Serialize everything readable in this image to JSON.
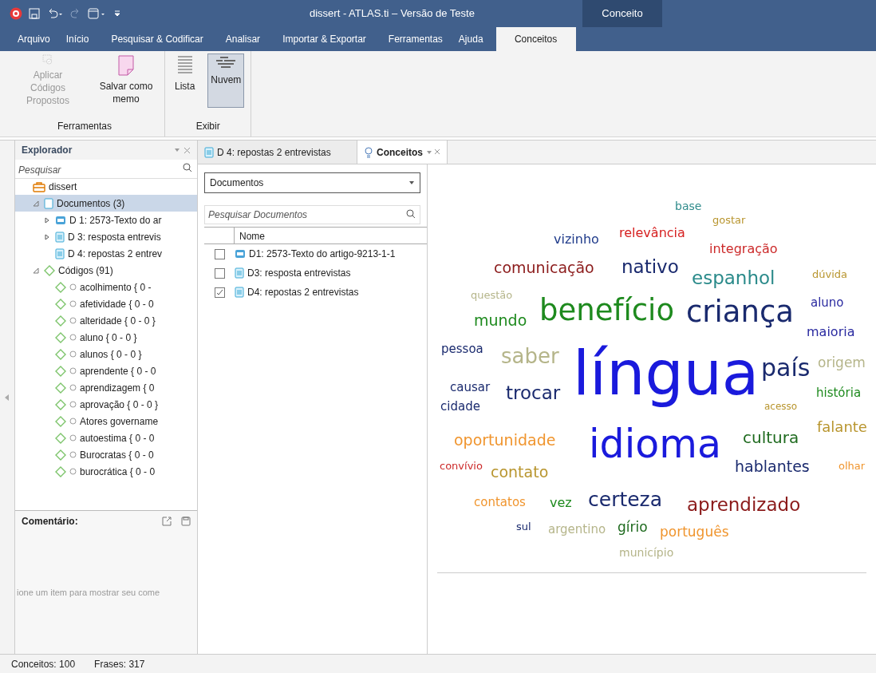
{
  "window": {
    "title": "dissert - ATLAS.ti – Versão de Teste",
    "context_tab": "Conceito"
  },
  "menu": [
    {
      "label": "Arquivo",
      "selected": false
    },
    {
      "label": "Início",
      "selected": false
    },
    {
      "label": "Pesquisar & Codificar",
      "selected": false
    },
    {
      "label": "Analisar",
      "selected": false
    },
    {
      "label": "Importar & Exportar",
      "selected": false
    },
    {
      "label": "Ferramentas",
      "selected": false
    },
    {
      "label": "Ajuda",
      "selected": false
    },
    {
      "label": "Conceitos",
      "selected": true
    }
  ],
  "ribbon": [
    {
      "label": "Ferramentas",
      "buttons": [
        {
          "kind": "apply",
          "label": "Aplicar Códigos Propostos",
          "disabled": true,
          "selected": false
        },
        {
          "kind": "memo",
          "label": "Salvar como memo",
          "disabled": false,
          "selected": false
        }
      ]
    },
    {
      "label": "Exibir",
      "buttons": [
        {
          "kind": "list",
          "label": "Lista",
          "disabled": false,
          "selected": false
        },
        {
          "kind": "cloud",
          "label": "Nuvem",
          "disabled": false,
          "selected": true
        }
      ]
    }
  ],
  "explorer": {
    "title": "Explorador",
    "search_placeholder": "Pesquisar",
    "tree": [
      {
        "kind": "project",
        "label": "dissert",
        "selected": false,
        "children": [
          {
            "kind": "folder",
            "label": "Documentos (3)",
            "selected": true,
            "expanded": true,
            "children": [
              {
                "kind": "pdf",
                "label": "D 1: 2573-Texto do ar",
                "selected": false,
                "expanded": false
              },
              {
                "kind": "doc",
                "label": "D 3: resposta entrevis",
                "selected": false,
                "expanded": false
              },
              {
                "kind": "doc",
                "label": "D 4: repostas 2 entrev",
                "selected": false
              }
            ]
          },
          {
            "kind": "codes",
            "label": "Códigos (91)",
            "selected": false,
            "expanded": true,
            "children": [
              {
                "kind": "code",
                "label": "acolhimento { 0 -",
                "selected": false
              },
              {
                "kind": "code",
                "label": "afetividade { 0 - 0",
                "selected": false
              },
              {
                "kind": "code",
                "label": "alteridade { 0 - 0 }",
                "selected": false
              },
              {
                "kind": "code",
                "label": "aluno { 0 - 0 }",
                "selected": false
              },
              {
                "kind": "code",
                "label": "alunos { 0 - 0 }",
                "selected": false
              },
              {
                "kind": "code",
                "label": "aprendente { 0 - 0",
                "selected": false
              },
              {
                "kind": "code",
                "label": "aprendizagem { 0",
                "selected": false
              },
              {
                "kind": "code",
                "label": "aprovação { 0 - 0 }",
                "selected": false
              },
              {
                "kind": "code",
                "label": "Atores govername",
                "selected": false
              },
              {
                "kind": "code",
                "label": "autoestima { 0 - 0",
                "selected": false
              },
              {
                "kind": "code",
                "label": "Burocratas { 0 - 0",
                "selected": false
              },
              {
                "kind": "code",
                "label": "burocrática { 0 - 0",
                "selected": false
              }
            ]
          }
        ]
      }
    ]
  },
  "comment": {
    "title": "Comentário:",
    "placeholder": "ione um item para mostrar seu come"
  },
  "doc_tabs": [
    {
      "label": "D 4: repostas 2 entrevistas",
      "kind": "doc",
      "selected": false
    },
    {
      "label": "Conceitos",
      "kind": "concepts",
      "selected": true
    }
  ],
  "documents": {
    "dropdown": "Documentos",
    "search_placeholder": "Pesquisar Documentos",
    "column": "Nome",
    "rows": [
      {
        "kind": "pdf",
        "label": "D1: 2573-Texto do artigo-9213-1-1",
        "checked": false
      },
      {
        "kind": "doc",
        "label": "D3: resposta entrevistas",
        "checked": false
      },
      {
        "kind": "doc",
        "label": "D4: repostas 2 entrevistas",
        "checked": true
      }
    ]
  },
  "cloud": [
    {
      "word": "base",
      "color": "#2e8b8b"
    },
    {
      "word": "gostar",
      "color": "#b8952e"
    },
    {
      "word": "vizinho",
      "color": "#1e3a8a"
    },
    {
      "word": "relevância",
      "color": "#d62020"
    },
    {
      "word": "integração",
      "color": "#cc2a2a"
    },
    {
      "word": "comunicação",
      "color": "#8b1a1a"
    },
    {
      "word": "nativo",
      "color": "#1a2a6e"
    },
    {
      "word": "espanhol",
      "color": "#2a8a8a"
    },
    {
      "word": "dúvida",
      "color": "#b8952e"
    },
    {
      "word": "questão",
      "color": "#b5b58a"
    },
    {
      "word": "aluno",
      "color": "#2a2aa0"
    },
    {
      "word": "mundo",
      "color": "#1e8a1e"
    },
    {
      "word": "benefício",
      "color": "#1e8a1e"
    },
    {
      "word": "criança",
      "color": "#1a2a6e"
    },
    {
      "word": "maioria",
      "color": "#2a2aa0"
    },
    {
      "word": "pessoa",
      "color": "#1a2a6e"
    },
    {
      "word": "saber",
      "color": "#b5b58a"
    },
    {
      "word": "língua",
      "color": "#1a1adc"
    },
    {
      "word": "país",
      "color": "#1a2a6e"
    },
    {
      "word": "origem",
      "color": "#b5b58a"
    },
    {
      "word": "causar",
      "color": "#1a2a6e"
    },
    {
      "word": "trocar",
      "color": "#1a2a6e"
    },
    {
      "word": "história",
      "color": "#1e8a1e"
    },
    {
      "word": "cidade",
      "color": "#1a2a6e"
    },
    {
      "word": "acesso",
      "color": "#b8952e"
    },
    {
      "word": "falante",
      "color": "#b8952e"
    },
    {
      "word": "oportunidade",
      "color": "#f0952e"
    },
    {
      "word": "idioma",
      "color": "#1a1adc"
    },
    {
      "word": "cultura",
      "color": "#1e6a1e"
    },
    {
      "word": "convívio",
      "color": "#cc2a2a"
    },
    {
      "word": "contato",
      "color": "#b8952e"
    },
    {
      "word": "hablantes",
      "color": "#1a2a6e"
    },
    {
      "word": "olhar",
      "color": "#f0952e"
    },
    {
      "word": "contatos",
      "color": "#f0952e"
    },
    {
      "word": "vez",
      "color": "#1e8a1e"
    },
    {
      "word": "certeza",
      "color": "#1a2a6e"
    },
    {
      "word": "aprendizado",
      "color": "#8b1a1a"
    },
    {
      "word": "sul",
      "color": "#1a2a6e"
    },
    {
      "word": "argentino",
      "color": "#b5b58a"
    },
    {
      "word": "gírio",
      "color": "#1e6a1e"
    },
    {
      "word": "português",
      "color": "#f0952e"
    },
    {
      "word": "município",
      "color": "#b5b58a"
    }
  ],
  "status_bar": [
    "Conceitos: 100",
    "Frases: 317"
  ]
}
